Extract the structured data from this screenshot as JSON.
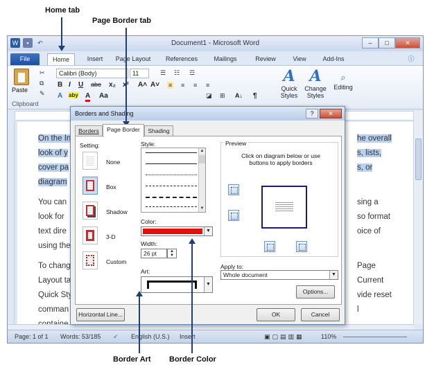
{
  "annotations": {
    "home_tab": "Home tab",
    "page_border_tab": "Page Border tab",
    "border_art": "Border Art",
    "border_color": "Border Color"
  },
  "window": {
    "title": "Document1 - Microsoft Word",
    "icon": "word-icon",
    "buttons": [
      "minimize-icon",
      "maximize-icon",
      "close-icon"
    ]
  },
  "ribbon_tabs": [
    "File",
    "Home",
    "Insert",
    "Page Layout",
    "References",
    "Mailings",
    "Review",
    "View",
    "Add-Ins"
  ],
  "ribbon": {
    "paste_label": "Paste",
    "font_name": "Calibri (Body)",
    "font_size": "11",
    "clipboard_group": "Clipboard",
    "quick_styles": "Quick Styles",
    "change_styles": "Change Styles",
    "editing": "Editing",
    "format_glyphs": [
      "B",
      "I",
      "U",
      "abe",
      "x₂",
      "x²",
      "A",
      "aby",
      "A",
      "Aa",
      "A˄",
      "A˅",
      "¶",
      "A↓"
    ]
  },
  "document": {
    "lines": [
      {
        "left": "On the In",
        "right": "he overall",
        "highlight": true
      },
      {
        "left": "look of y",
        "right": "s, lists,",
        "highlight": true
      },
      {
        "left": "cover pa",
        "right": "s, or",
        "highlight": true
      },
      {
        "left": "diagram",
        "right": "",
        "highlight": true
      },
      {
        "left": "You can",
        "right": "sing a",
        "highlight": false
      },
      {
        "left": "look for",
        "right": "so format",
        "highlight": false
      },
      {
        "left": "text dire",
        "right": "oice of",
        "highlight": false
      },
      {
        "left": "using the",
        "right": "",
        "highlight": false
      },
      {
        "left": "To chang",
        "right": "Page",
        "highlight": false
      },
      {
        "left": "Layout ta",
        "right": "Current",
        "highlight": false
      },
      {
        "left": "Quick Sty",
        "right": "vide reset",
        "highlight": false
      },
      {
        "left": "comman",
        "right": "l",
        "highlight": false
      },
      {
        "left": "containe",
        "right": "",
        "highlight": false
      }
    ]
  },
  "status": {
    "page": "Page: 1 of 1",
    "words": "Words: 53/185",
    "language": "English (U.S.)",
    "mode": "Insert",
    "zoom": "110%"
  },
  "dialog": {
    "title": "Borders and Shading",
    "tabs": [
      "Borders",
      "Page Border",
      "Shading"
    ],
    "setting_label": "Setting:",
    "settings": [
      "None",
      "Box",
      "Shadow",
      "3-D",
      "Custom"
    ],
    "style_label": "Style:",
    "color_label": "Color:",
    "color_value": "#e01010",
    "width_label": "Width:",
    "width_value": "26 pt",
    "art_label": "Art:",
    "preview_label": "Preview",
    "preview_hint": "Click on diagram below or use buttons to apply borders",
    "apply_to_label": "Apply to:",
    "apply_to_value": "Whole document",
    "options_button": "Options...",
    "horizontal_line_button": "Horizontal Line...",
    "ok_button": "OK",
    "cancel_button": "Cancel"
  }
}
